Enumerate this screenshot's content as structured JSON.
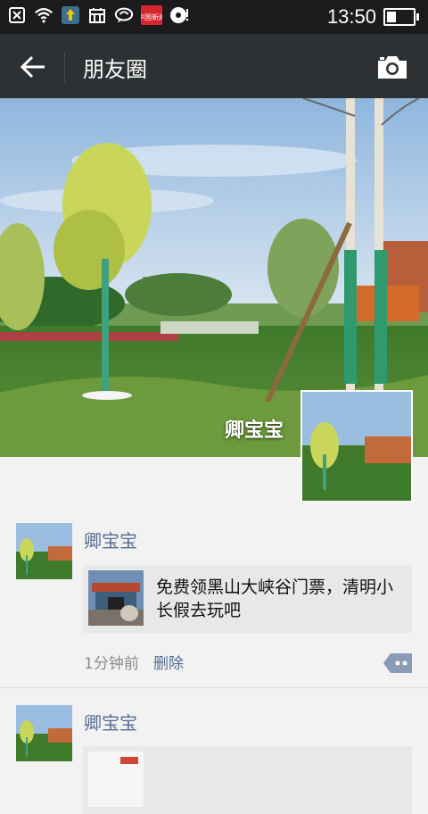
{
  "status_bar": {
    "time": "13:50",
    "battery_level": 0.35,
    "icons": [
      "notification-icon",
      "wifi-icon",
      "app-update-icon",
      "calendar-icon",
      "chat-icon",
      "news-app-icon",
      "media-icon"
    ],
    "news_badge": "中国新闻"
  },
  "nav": {
    "title": "朋友圈",
    "back_icon": "back-arrow-icon",
    "camera_icon": "camera-icon"
  },
  "cover": {
    "user_name": "卿宝宝"
  },
  "posts": [
    {
      "name": "卿宝宝",
      "share_text": "免费领黑山大峡谷门票，清明小长假去玩吧",
      "time": "1分钟前",
      "delete_label": "删除"
    },
    {
      "name": "卿宝宝",
      "share_text": ""
    }
  ],
  "colors": {
    "nav_bg": "#2e3133",
    "status_bg": "#1b1b1b",
    "link": "#576b95",
    "page_bg": "#f2f2f2"
  }
}
